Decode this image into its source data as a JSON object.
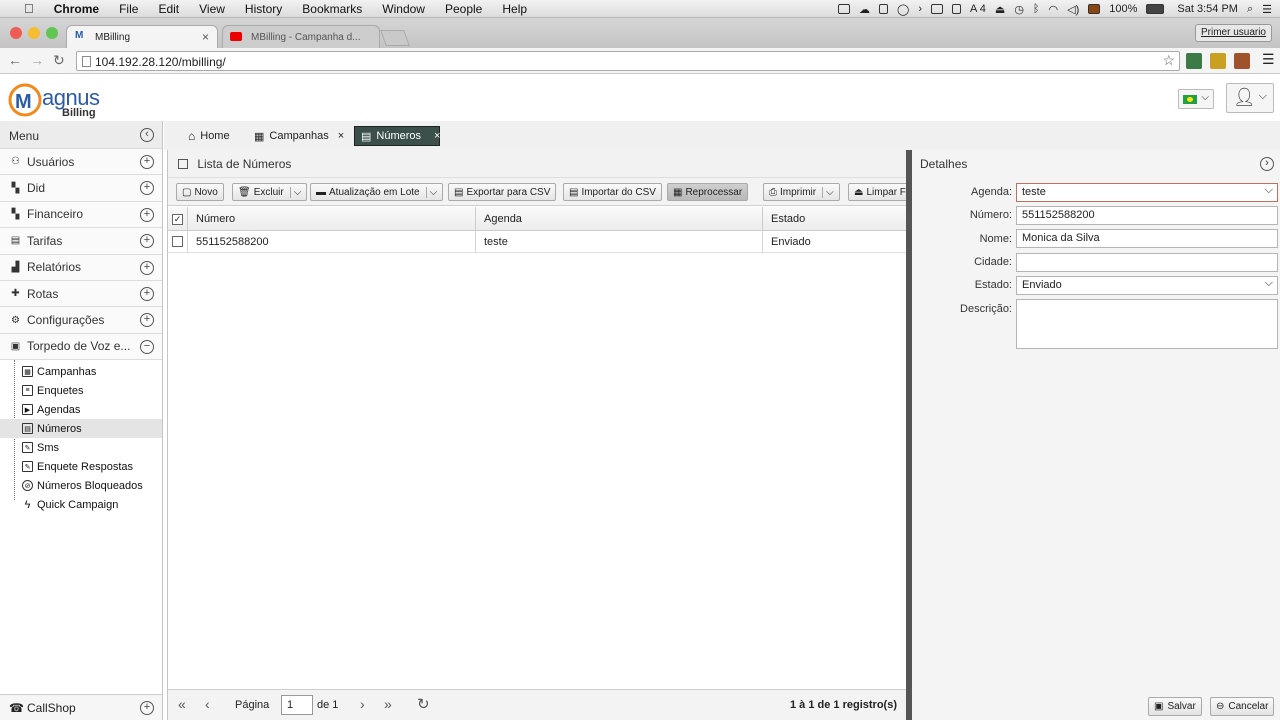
{
  "macbar": {
    "apple": "",
    "menus": [
      "Chrome",
      "File",
      "Edit",
      "View",
      "History",
      "Bookmarks",
      "Window",
      "People",
      "Help"
    ],
    "battery": "100%",
    "clock": "Sat 3:54 PM",
    "input": "A 4"
  },
  "browser": {
    "tabs": [
      {
        "title": "MBilling",
        "active": true
      },
      {
        "title": "MBilling - Campanha d...",
        "active": false
      }
    ],
    "user": "Primer usuario",
    "url": "104.192.28.120/mbilling/"
  },
  "app": {
    "logo_text": "agnus",
    "logo_sub": "Billing"
  },
  "sidebar": {
    "title": "Menu",
    "items": [
      {
        "label": "Usuários",
        "icon": "user-icon"
      },
      {
        "label": "Did",
        "icon": "did-icon"
      },
      {
        "label": "Financeiro",
        "icon": "finance-icon"
      },
      {
        "label": "Tarifas",
        "icon": "rates-icon"
      },
      {
        "label": "Relatórios",
        "icon": "reports-icon"
      },
      {
        "label": "Rotas",
        "icon": "routes-icon"
      },
      {
        "label": "Configurações",
        "icon": "gear-icon"
      },
      {
        "label": "Torpedo de Voz e...",
        "icon": "campaign-icon"
      }
    ],
    "subitems": [
      {
        "label": "Campanhas"
      },
      {
        "label": "Enquetes"
      },
      {
        "label": "Agendas"
      },
      {
        "label": "Números",
        "selected": true
      },
      {
        "label": "Sms"
      },
      {
        "label": "Enquete Respostas"
      },
      {
        "label": "Números Bloqueados"
      },
      {
        "label": "Quick Campaign"
      }
    ],
    "footer": "CallShop"
  },
  "tabs": {
    "home": "Home",
    "campanhas": "Campanhas",
    "numeros": "Números"
  },
  "grid": {
    "title": "Lista de Números",
    "toolbar": {
      "novo": "Novo",
      "excluir": "Excluir",
      "lote": "Atualização em Lote",
      "exportar": "Exportar para CSV",
      "importar": "Importar do CSV",
      "reprocessar": "Reprocessar",
      "imprimir": "Imprimir",
      "limpar": "Limpar F"
    },
    "columns": [
      "Número",
      "Agenda",
      "Estado"
    ],
    "rows": [
      {
        "numero": "551152588200",
        "agenda": "teste",
        "estado": "Enviado"
      }
    ],
    "pager": {
      "pagina": "Página",
      "page_value": "1",
      "de": "de 1",
      "summary": "1 à 1 de 1 registro(s)"
    }
  },
  "detail": {
    "title": "Detalhes",
    "fields": {
      "agenda": {
        "label": "Agenda:",
        "value": "teste"
      },
      "numero": {
        "label": "Número:",
        "value": "551152588200"
      },
      "nome": {
        "label": "Nome:",
        "value": "Monica da Silva"
      },
      "cidade": {
        "label": "Cidade:",
        "value": ""
      },
      "estado": {
        "label": "Estado:",
        "value": "Enviado"
      },
      "descricao": {
        "label": "Descrição:",
        "value": ""
      }
    },
    "salvar": "Salvar",
    "cancelar": "Cancelar"
  },
  "colors": {
    "active_tab": "#3b4f4b",
    "logo_orange": "#f08a1c",
    "logo_blue": "#2a5ca8"
  }
}
